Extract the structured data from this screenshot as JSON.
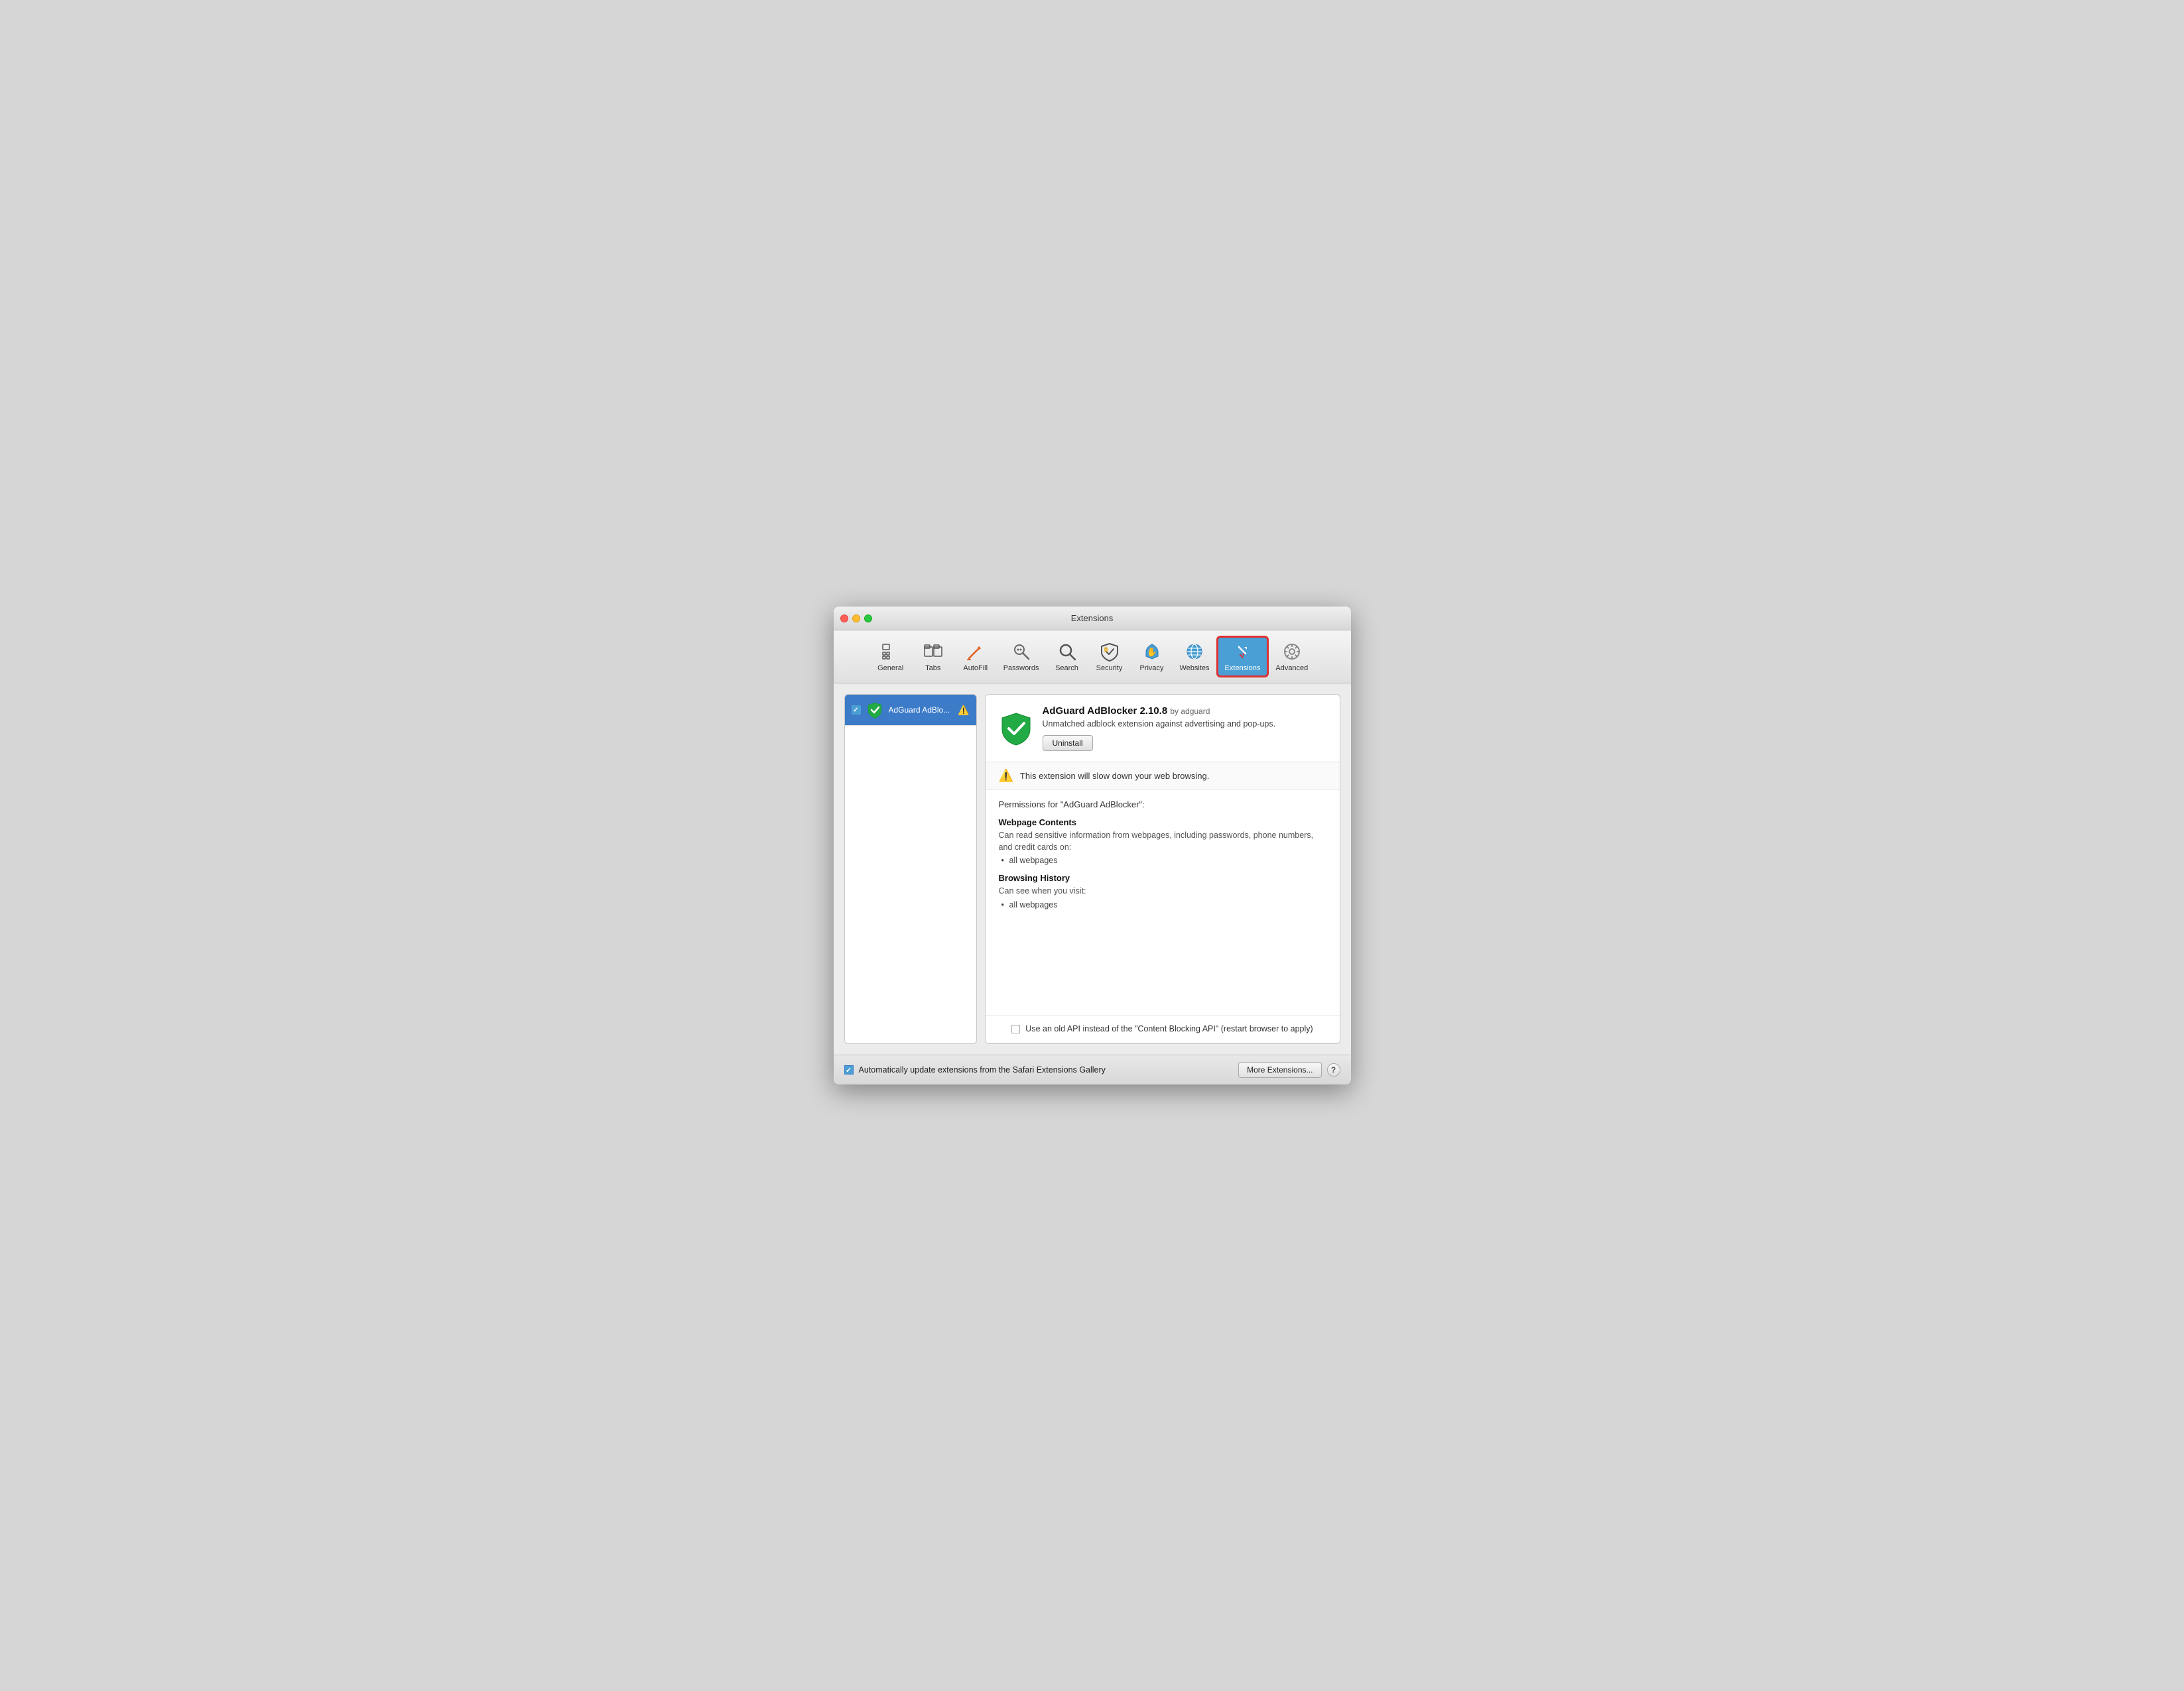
{
  "window": {
    "title": "Extensions",
    "traffic_lights": {
      "close": "close",
      "minimize": "minimize",
      "maximize": "maximize"
    }
  },
  "toolbar": {
    "items": [
      {
        "id": "general",
        "label": "General",
        "icon": "⚙",
        "active": false
      },
      {
        "id": "tabs",
        "label": "Tabs",
        "icon": "▢▢",
        "active": false
      },
      {
        "id": "autofill",
        "label": "AutoFill",
        "icon": "✏",
        "active": false
      },
      {
        "id": "passwords",
        "label": "Passwords",
        "icon": "🔑",
        "active": false
      },
      {
        "id": "search",
        "label": "Search",
        "icon": "🔍",
        "active": false
      },
      {
        "id": "security",
        "label": "Security",
        "icon": "🛡",
        "active": false
      },
      {
        "id": "privacy",
        "label": "Privacy",
        "icon": "✋",
        "active": false
      },
      {
        "id": "websites",
        "label": "Websites",
        "icon": "🌐",
        "active": false
      },
      {
        "id": "extensions",
        "label": "Extensions",
        "icon": "🧩",
        "active": true,
        "highlighted": true
      },
      {
        "id": "advanced",
        "label": "Advanced",
        "icon": "⚙",
        "active": false
      }
    ]
  },
  "sidebar": {
    "items": [
      {
        "id": "adguard",
        "label": "AdGuard AdBlo...",
        "checked": true,
        "selected": true,
        "has_warning": true
      }
    ]
  },
  "detail": {
    "name": "AdGuard AdBlocker 2.10.8",
    "author": "by adguard",
    "description": "Unmatched adblock extension against advertising and pop-ups.",
    "uninstall_label": "Uninstall",
    "warning_text": "This extension will slow down your web browsing.",
    "permissions_title": "Permissions for \"AdGuard AdBlocker\":",
    "permissions": [
      {
        "heading": "Webpage Contents",
        "description": "Can read sensitive information from webpages, including passwords, phone numbers, and credit cards on:",
        "items": [
          "all webpages"
        ]
      },
      {
        "heading": "Browsing History",
        "description": "Can see when you visit:",
        "items": [
          "all webpages"
        ]
      }
    ],
    "old_api_label": "Use an old API instead of the \"Content Blocking API\" (restart browser to apply)",
    "old_api_checked": false
  },
  "bottom_bar": {
    "auto_update_checked": true,
    "auto_update_label": "Automatically update extensions from the Safari Extensions Gallery",
    "more_extensions_label": "More Extensions...",
    "help_label": "?"
  }
}
